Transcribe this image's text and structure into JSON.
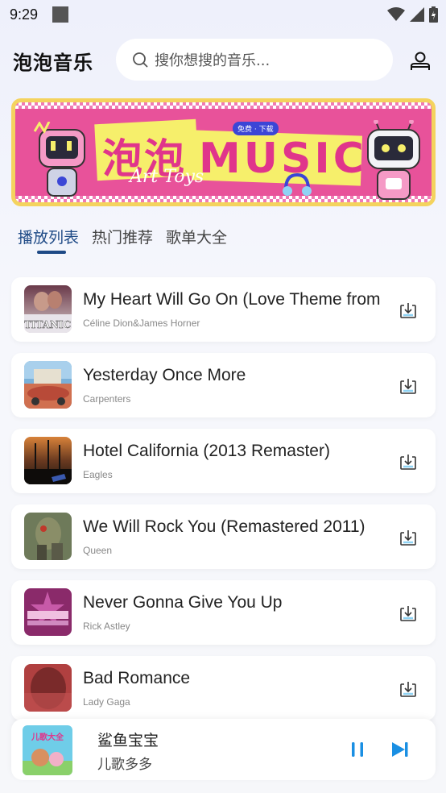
{
  "status_bar": {
    "time": "9:29"
  },
  "header": {
    "app_title": "泡泡音乐",
    "search_placeholder": "搜你想搜的音乐..."
  },
  "banner": {
    "title_cn": "泡泡",
    "title_en": "MUSIC",
    "subtitle": "Art Toys",
    "tag": "免费 · 下载"
  },
  "tabs": [
    {
      "label": "播放列表",
      "active": true
    },
    {
      "label": "热门推荐",
      "active": false
    },
    {
      "label": "歌单大全",
      "active": false
    }
  ],
  "songs": [
    {
      "title": "My Heart Will Go On (Love Theme from",
      "artist": "Céline Dion&James Horner",
      "cover_text": "TITANIC"
    },
    {
      "title": "Yesterday Once More",
      "artist": "Carpenters"
    },
    {
      "title": "Hotel California (2013 Remaster)",
      "artist": "Eagles"
    },
    {
      "title": "We Will Rock You (Remastered 2011)",
      "artist": "Queen"
    },
    {
      "title": "Never Gonna Give You Up",
      "artist": "Rick Astley"
    },
    {
      "title": "Bad Romance",
      "artist": "Lady Gaga"
    }
  ],
  "player": {
    "title": "鲨鱼宝宝",
    "subtitle": "儿歌多多",
    "cover_text": "儿歌大全"
  },
  "colors": {
    "accent": "#1e4a86",
    "play_controls": "#1a8fe3",
    "banner_pink": "#e8529a",
    "banner_yellow": "#f6ef6b"
  }
}
